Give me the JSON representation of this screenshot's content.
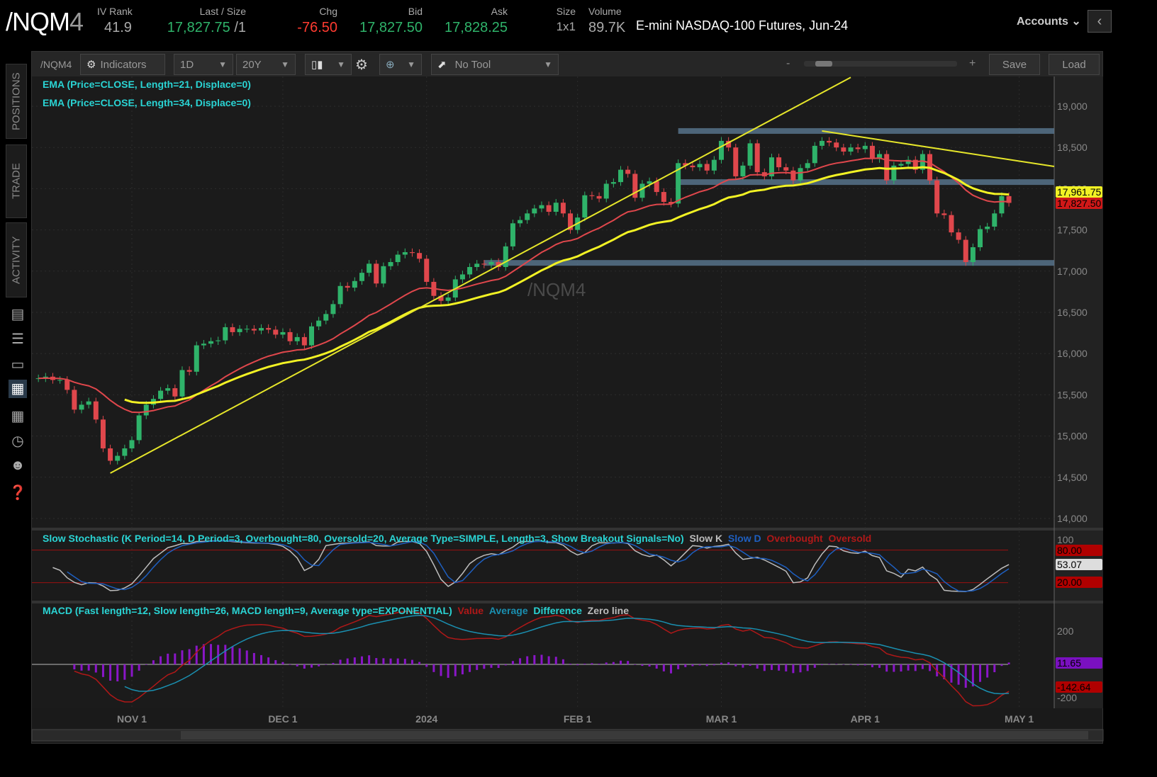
{
  "header": {
    "symbol_main": "/NQM",
    "symbol_suffix": "4",
    "iv_rank_label": "IV Rank",
    "iv_rank": "41.9",
    "last_label": "Last / Size",
    "last": "17,827.75",
    "size": "/1",
    "chg_label": "Chg",
    "chg": "-76.50",
    "bid_label": "Bid",
    "bid": "17,827.50",
    "ask_label": "Ask",
    "ask": "17,828.25",
    "sizeq_label": "Size",
    "sizeq": "1x1",
    "volume_label": "Volume",
    "volume": "89.7K",
    "description": "E-mini NASDAQ-100 Futures, Jun-24",
    "accounts": "Accounts"
  },
  "sidebar": {
    "tabs": [
      "POSITIONS",
      "TRADE",
      "ACTIVITY"
    ],
    "icons": [
      "monitor-icon",
      "list-icon",
      "tv-icon",
      "chart-icon",
      "grid-icon",
      "clock-icon",
      "people-icon",
      "help-icon"
    ]
  },
  "toolbar": {
    "symbol": "/NQM4",
    "indicators": "Indicators",
    "timeframe": "1D",
    "range": "20Y",
    "tool": "No Tool",
    "zoom_minus": "-",
    "zoom_plus": "+",
    "save": "Save",
    "load": "Load"
  },
  "studies": {
    "ema21": "EMA (Price=CLOSE, Length=21, Displace=0)",
    "ema34": "EMA (Price=CLOSE, Length=34, Displace=0)",
    "stoch": "Slow Stochastic (K Period=14, D Period=3, Overbought=80, Oversold=20, Average Type=SIMPLE, Length=3, Show Breakout Signals=No)",
    "stoch_legend": [
      "Slow K",
      "Slow D",
      "Overbought",
      "Oversold"
    ],
    "macd": "MACD (Fast length=12, Slow length=26, MACD length=9, Average type=EXPONENTIAL)",
    "macd_legend": [
      "Value",
      "Average",
      "Difference",
      "Zero line"
    ]
  },
  "watermark": "/NQM4",
  "colors": {
    "up": "#2fb36a",
    "down": "#e0474c",
    "ema21": "#e0474c",
    "ema34": "#f2f224",
    "trend": "#e6e62a",
    "zone": "#5f7f99",
    "slowK": "#bdbdbd",
    "slowD": "#1e5fc0",
    "macd_value": "#b01818",
    "macd_avg": "#1a8fb0",
    "macd_diff": "#8a16c8"
  },
  "chart_data": {
    "type": "candlestick",
    "price_axis": {
      "min": 14000,
      "max": 19000,
      "ticks": [
        "14,000",
        "14,500",
        "15,000",
        "15,500",
        "16,000",
        "16,500",
        "17,000",
        "17,500",
        "18,000",
        "18,500",
        "19,000"
      ]
    },
    "date_ticks": [
      {
        "label": "NOV 1",
        "date": "2023-11-01"
      },
      {
        "label": "DEC 1",
        "date": "2023-12-01"
      },
      {
        "label": "2024",
        "date": "2024-01-02"
      },
      {
        "label": "FEB 1",
        "date": "2024-02-01"
      },
      {
        "label": "MAR 1",
        "date": "2024-03-01"
      },
      {
        "label": "APR 1",
        "date": "2024-04-01"
      },
      {
        "label": "MAY 1",
        "date": "2024-05-01"
      }
    ],
    "price_labels": {
      "ema34": "17,961.75",
      "last": "17,827.50"
    },
    "stoch_axis": {
      "ticks": [
        "100"
      ],
      "overbought": "80.00",
      "oversold": "20.00",
      "slowK_last": "53.07"
    },
    "macd_axis": {
      "ticks": [
        "200",
        "-200"
      ],
      "diff_last": "11.65",
      "value_last": "-142.64"
    },
    "dates": [
      "2023-10-13",
      "2023-10-16",
      "2023-10-17",
      "2023-10-18",
      "2023-10-19",
      "2023-10-20",
      "2023-10-23",
      "2023-10-24",
      "2023-10-25",
      "2023-10-26",
      "2023-10-27",
      "2023-10-30",
      "2023-10-31",
      "2023-11-01",
      "2023-11-02",
      "2023-11-03",
      "2023-11-06",
      "2023-11-07",
      "2023-11-08",
      "2023-11-09",
      "2023-11-10",
      "2023-11-13",
      "2023-11-14",
      "2023-11-15",
      "2023-11-16",
      "2023-11-17",
      "2023-11-20",
      "2023-11-21",
      "2023-11-22",
      "2023-11-24",
      "2023-11-27",
      "2023-11-28",
      "2023-11-29",
      "2023-11-30",
      "2023-12-01",
      "2023-12-04",
      "2023-12-05",
      "2023-12-06",
      "2023-12-07",
      "2023-12-08",
      "2023-12-11",
      "2023-12-12",
      "2023-12-13",
      "2023-12-14",
      "2023-12-15",
      "2023-12-18",
      "2023-12-19",
      "2023-12-20",
      "2023-12-21",
      "2023-12-22",
      "2023-12-26",
      "2023-12-27",
      "2023-12-28",
      "2023-12-29",
      "2024-01-02",
      "2024-01-03",
      "2024-01-04",
      "2024-01-05",
      "2024-01-08",
      "2024-01-09",
      "2024-01-10",
      "2024-01-11",
      "2024-01-12",
      "2024-01-16",
      "2024-01-17",
      "2024-01-18",
      "2024-01-19",
      "2024-01-22",
      "2024-01-23",
      "2024-01-24",
      "2024-01-25",
      "2024-01-26",
      "2024-01-29",
      "2024-01-30",
      "2024-01-31",
      "2024-02-01",
      "2024-02-02",
      "2024-02-05",
      "2024-02-06",
      "2024-02-07",
      "2024-02-08",
      "2024-02-09",
      "2024-02-12",
      "2024-02-13",
      "2024-02-14",
      "2024-02-15",
      "2024-02-16",
      "2024-02-20",
      "2024-02-21",
      "2024-02-22",
      "2024-02-23",
      "2024-02-26",
      "2024-02-27",
      "2024-02-28",
      "2024-02-29",
      "2024-03-01",
      "2024-03-04",
      "2024-03-05",
      "2024-03-06",
      "2024-03-07",
      "2024-03-08",
      "2024-03-11",
      "2024-03-12",
      "2024-03-13",
      "2024-03-14",
      "2024-03-15",
      "2024-03-18",
      "2024-03-19",
      "2024-03-20",
      "2024-03-21",
      "2024-03-22",
      "2024-03-25",
      "2024-03-26",
      "2024-03-27",
      "2024-03-28",
      "2024-04-01",
      "2024-04-02",
      "2024-04-03",
      "2024-04-04",
      "2024-04-05",
      "2024-04-08",
      "2024-04-09",
      "2024-04-10",
      "2024-04-11",
      "2024-04-12",
      "2024-04-15",
      "2024-04-16",
      "2024-04-17",
      "2024-04-18",
      "2024-04-19",
      "2024-04-22",
      "2024-04-23",
      "2024-04-24",
      "2024-04-25",
      "2024-04-26",
      "2024-04-29"
    ],
    "close": [
      15700,
      15720,
      15680,
      15680,
      15560,
      15320,
      15380,
      15420,
      15200,
      14850,
      14700,
      14760,
      14850,
      14950,
      15250,
      15380,
      15450,
      15550,
      15580,
      15480,
      15800,
      15780,
      16100,
      16120,
      16150,
      16160,
      16320,
      16260,
      16300,
      16300,
      16280,
      16310,
      16290,
      16230,
      16260,
      16150,
      16200,
      16100,
      16330,
      16400,
      16480,
      16600,
      16820,
      16800,
      16880,
      16980,
      17090,
      16850,
      17060,
      17110,
      17200,
      17230,
      17220,
      17150,
      16870,
      16700,
      16640,
      16680,
      16900,
      16960,
      17050,
      17090,
      17080,
      17110,
      17050,
      17300,
      17580,
      17620,
      17700,
      17760,
      17800,
      17720,
      17830,
      17700,
      17500,
      17650,
      17920,
      17910,
      17880,
      18060,
      18080,
      18230,
      18180,
      17890,
      18060,
      18090,
      17960,
      17840,
      17820,
      18310,
      18280,
      18260,
      18300,
      18220,
      18350,
      18580,
      18500,
      18150,
      18280,
      18550,
      18200,
      18150,
      18380,
      18260,
      18220,
      18100,
      18250,
      18310,
      18520,
      18580,
      18560,
      18500,
      18450,
      18500,
      18480,
      18520,
      18360,
      18420,
      18100,
      18280,
      18300,
      18350,
      18230,
      18420,
      18100,
      17700,
      17680,
      17470,
      17380,
      17110,
      17290,
      17510,
      17540,
      17700,
      17910,
      17828
    ],
    "trendlines": [
      {
        "from": {
          "date": "2023-10-27",
          "price": 14550
        },
        "to": {
          "date": "2024-03-27",
          "price": 19350
        }
      },
      {
        "from": {
          "date": "2024-03-21",
          "price": 18700
        },
        "to": {
          "date": "2024-05-10",
          "price": 18270
        }
      }
    ],
    "zones": [
      {
        "from": "2024-02-22",
        "price": 18700
      },
      {
        "from": "2024-02-22",
        "price": 18080
      },
      {
        "from": "2024-01-12",
        "price": 17100
      }
    ]
  }
}
